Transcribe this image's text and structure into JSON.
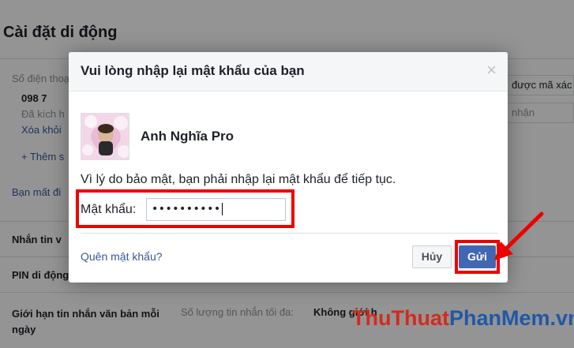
{
  "background": {
    "title": "Cài đặt di động",
    "phone_label": "Số điện thoại",
    "phone_number": "098 7",
    "activated": "Đã kích h",
    "remove_link": "Xóa khỏi",
    "add_more": "+ Thêm s",
    "lost_phone": "Bạn mất đi",
    "right_code": "được mã xác",
    "right_receive": "nhận",
    "text_msg_label": "Nhắn tin v",
    "pin_label": "PIN di động",
    "limit_label": "Giới hạn tin nhắn văn bản mỗi ngày",
    "limit_value_prefix": "Số lượng tin nhắn tối đa:",
    "limit_value": "Không giới h"
  },
  "dialog": {
    "title": "Vui lòng nhập lại mật khẩu của bạn",
    "close_symbol": "×",
    "user_name": "Anh Nghĩa Pro",
    "message": "Vì lý do bảo mật, bạn phải nhập lại mật khẩu để tiếp tục.",
    "password_label": "Mật khẩu:",
    "password_value": "••••••••••",
    "forgot_link": "Quên mật khẩu?",
    "cancel_label": "Hủy",
    "send_label": "Gửi"
  },
  "watermark": {
    "part1": "ThuThuat",
    "part2": "PhanMem",
    "part3": ".vn"
  },
  "colors": {
    "highlight": "#ee0000",
    "primary_button": "#4267b2",
    "link": "#385898"
  }
}
